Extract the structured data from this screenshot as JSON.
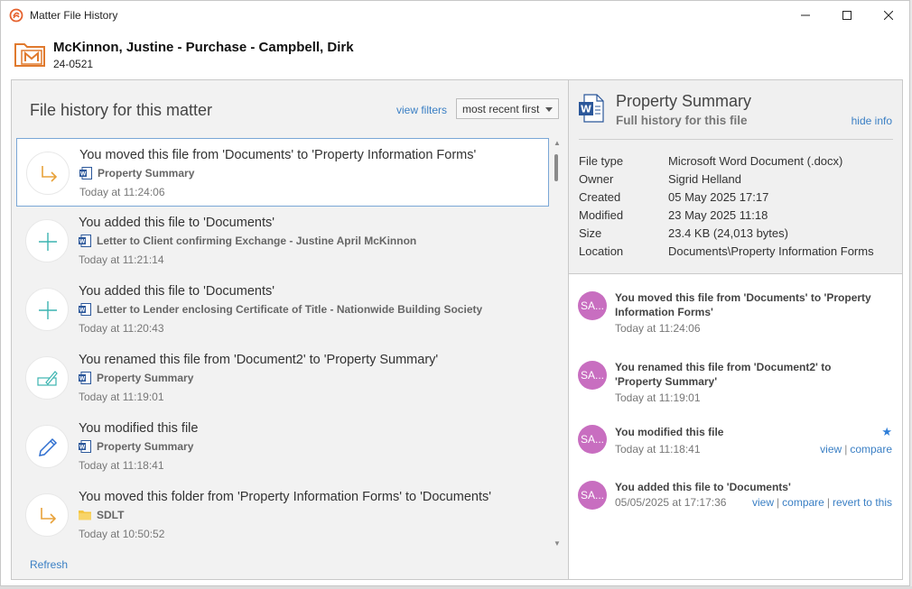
{
  "window": {
    "title": "Matter File History",
    "controls": {
      "minimize": "—",
      "maximize": "☐",
      "close": "✕"
    }
  },
  "matter": {
    "title": "McKinnon, Justine - Purchase - Campbell, Dirk",
    "number": "24-0521"
  },
  "left": {
    "heading": "File history for this matter",
    "view_filters": "view filters",
    "sort_value": "most recent first",
    "refresh": "Refresh",
    "items": [
      {
        "icon": "move-icon",
        "title": "You moved this file from 'Documents' to 'Property Information Forms'",
        "file": "Property Summary",
        "file_icon": "word-icon",
        "time": "Today at 11:24:06"
      },
      {
        "icon": "add-icon",
        "title": "You added this file to 'Documents'",
        "file": "Letter to Client confirming Exchange - Justine April McKinnon",
        "file_icon": "word-icon",
        "time": "Today at 11:21:14"
      },
      {
        "icon": "add-icon",
        "title": "You added this file to 'Documents'",
        "file": "Letter to Lender enclosing Certificate of Title - Nationwide Building Society",
        "file_icon": "word-icon",
        "time": "Today at 11:20:43"
      },
      {
        "icon": "rename-icon",
        "title": "You renamed this file from 'Document2' to 'Property Summary'",
        "file": "Property Summary",
        "file_icon": "word-icon",
        "time": "Today at 11:19:01"
      },
      {
        "icon": "edit-icon",
        "title": "You modified this file",
        "file": "Property Summary",
        "file_icon": "word-icon",
        "time": "Today at 11:18:41"
      },
      {
        "icon": "move-icon",
        "title": "You moved this folder from 'Property Information Forms' to 'Documents'",
        "file": "SDLT",
        "file_icon": "folder-icon",
        "time": "Today at 10:50:52"
      }
    ]
  },
  "info": {
    "title": "Property Summary",
    "subtitle": "Full history for this file",
    "hide_info": "hide info",
    "properties": [
      {
        "key": "File type",
        "value": "Microsoft Word Document (.docx)"
      },
      {
        "key": "Owner",
        "value": "Sigrid Helland"
      },
      {
        "key": "Created",
        "value": "05 May 2025 17:17"
      },
      {
        "key": "Modified",
        "value": "23 May 2025 11:18"
      },
      {
        "key": "Size",
        "value": "23.4 KB (24,013 bytes)"
      },
      {
        "key": "Location",
        "value": "Documents\\Property Information Forms"
      }
    ]
  },
  "activity": [
    {
      "avatar": "SA...",
      "text": "You moved this file from 'Documents' to 'Property Information Forms'",
      "time": "Today at 11:24:06"
    },
    {
      "avatar": "SA...",
      "text": "You renamed this file from 'Document2' to 'Property Summary'",
      "time": "Today at 11:19:01"
    },
    {
      "avatar": "SA...",
      "text": "You modified this file",
      "time": "Today at 11:18:41",
      "starred": "★",
      "links": [
        "view",
        "compare"
      ]
    },
    {
      "avatar": "SA...",
      "text": "You added this file to 'Documents'",
      "time": "05/05/2025 at 17:17:36",
      "links": [
        "view",
        "compare",
        "revert to this"
      ]
    }
  ],
  "colors": {
    "accent": "#3a7fc4",
    "avatar": "#c86ec0",
    "move": "#e8a23a",
    "add": "#3cb4b0",
    "selected_border": "#7aa7d6"
  }
}
